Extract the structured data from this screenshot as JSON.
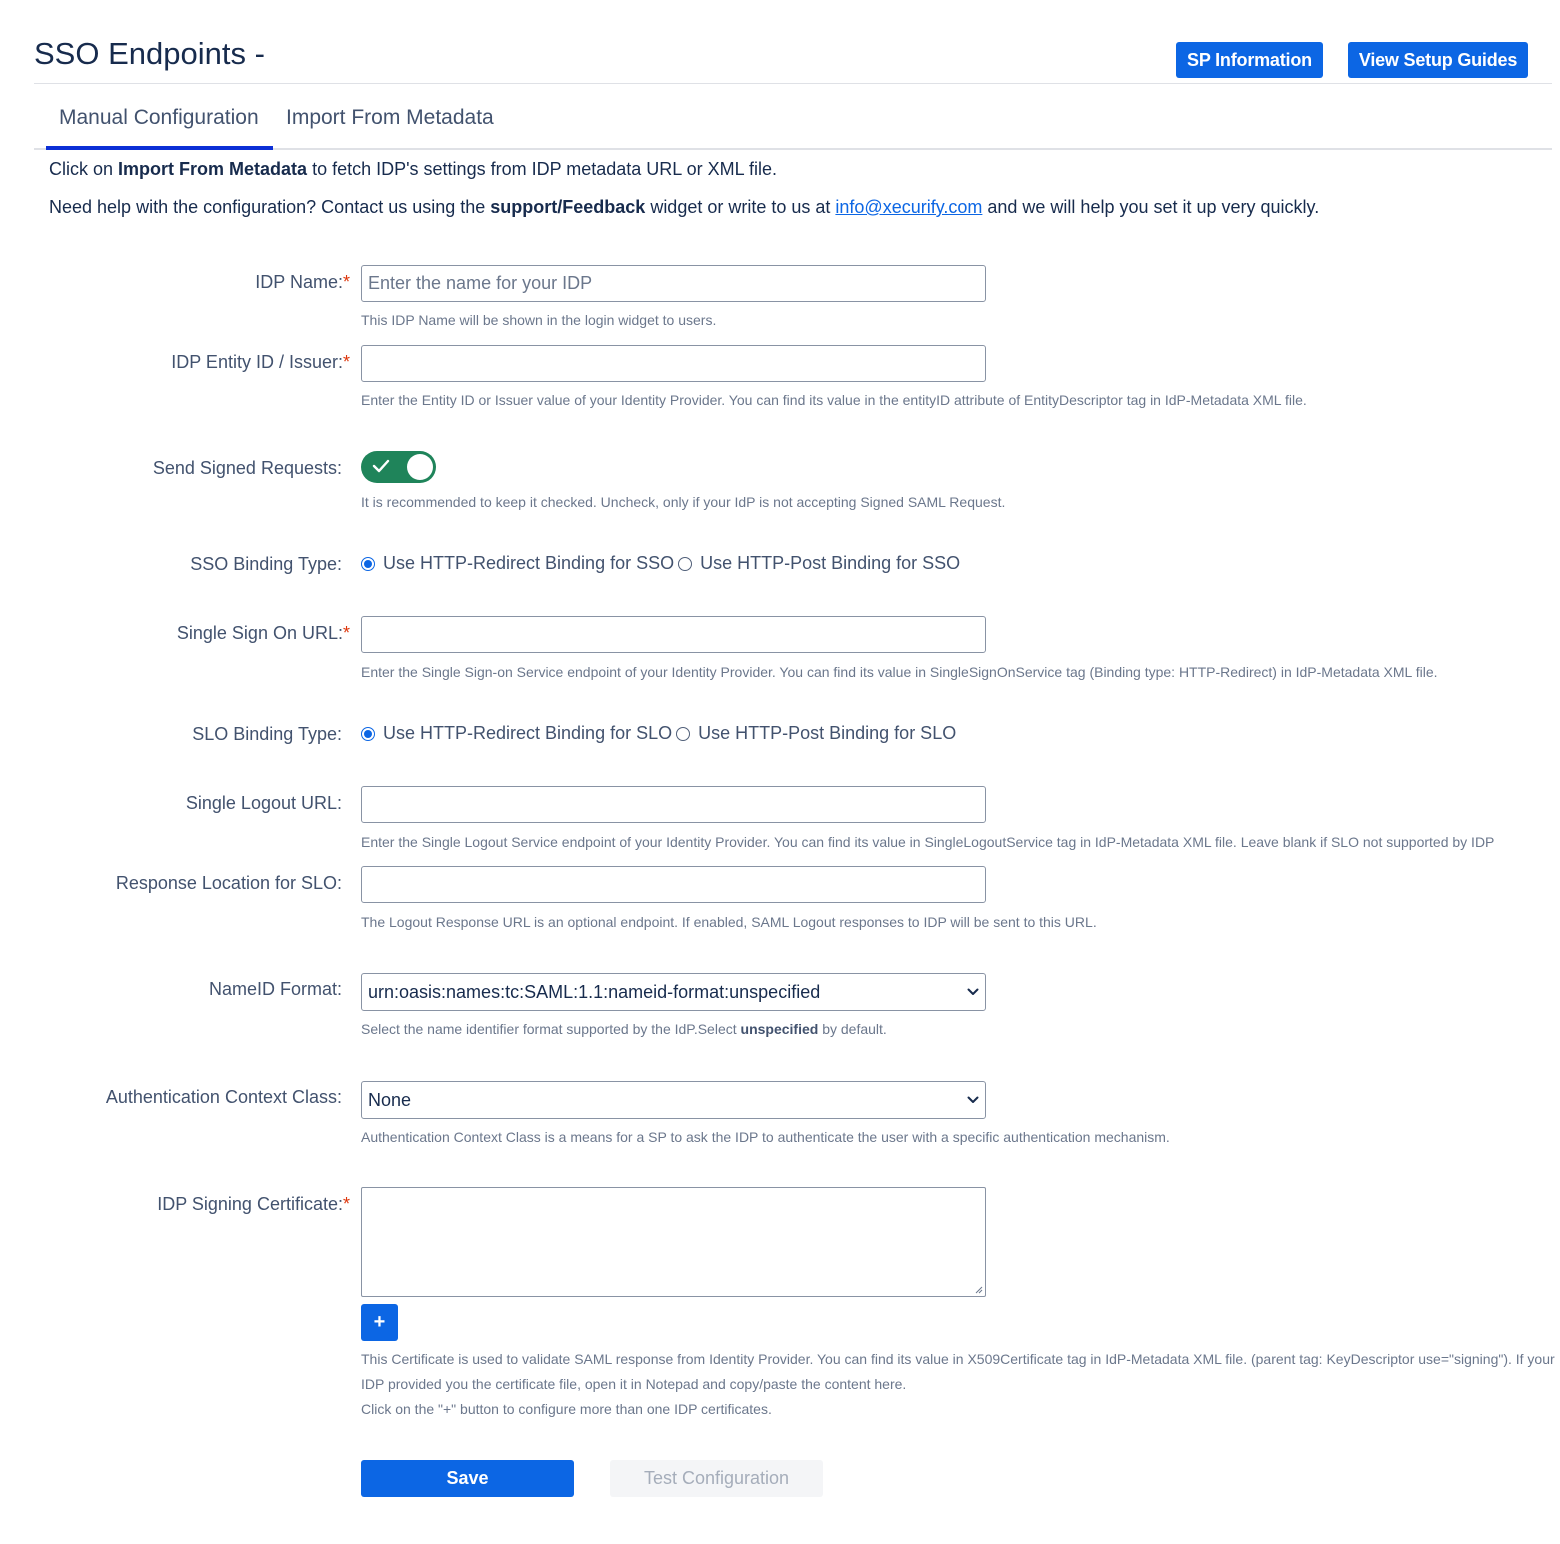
{
  "header": {
    "title": "SSO Endpoints -",
    "sp_info_button": "SP Information",
    "setup_guides_button": "View Setup Guides"
  },
  "tabs": [
    {
      "label": "Manual Configuration",
      "active": true
    },
    {
      "label": "Import From Metadata",
      "active": false
    }
  ],
  "intro": {
    "line1_pre": "Click on ",
    "line1_bold": "Import From Metadata",
    "line1_post": " to fetch IDP's settings from IDP metadata URL or XML file.",
    "line2_pre": "Need help with the configuration? Contact us using the ",
    "line2_bold": "support/Feedback",
    "line2_mid": " widget or write to us at ",
    "line2_link": "info@xecurify.com",
    "line2_post": " and we will help you set it up very quickly."
  },
  "form": {
    "idp_name": {
      "label": "IDP Name:",
      "required": "*",
      "value": "",
      "placeholder": "Enter the name for your IDP",
      "help": "This IDP Name will be shown in the login widget to users."
    },
    "entity_id": {
      "label": "IDP Entity ID / Issuer:",
      "required": "*",
      "value": "",
      "help": "Enter the Entity ID or Issuer value of your Identity Provider. You can find its value in the entityID attribute of EntityDescriptor tag in IdP-Metadata XML file."
    },
    "signed_requests": {
      "label": "Send Signed Requests:",
      "checked": true,
      "help": "It is recommended to keep it checked. Uncheck, only if your IdP is not accepting Signed SAML Request."
    },
    "sso_binding": {
      "label": "SSO Binding Type:",
      "options": [
        "Use HTTP-Redirect Binding for SSO",
        "Use HTTP-Post Binding for SSO"
      ],
      "selected": "Use HTTP-Redirect Binding for SSO"
    },
    "sso_url": {
      "label": "Single Sign On URL:",
      "required": "*",
      "value": "",
      "help": "Enter the Single Sign-on Service endpoint of your Identity Provider. You can find its value in SingleSignOnService tag (Binding type: HTTP-Redirect) in IdP-Metadata XML file."
    },
    "slo_binding": {
      "label": "SLO Binding Type:",
      "options": [
        "Use HTTP-Redirect Binding for SLO",
        "Use HTTP-Post Binding for SLO"
      ],
      "selected": "Use HTTP-Redirect Binding for SLO"
    },
    "slo_url": {
      "label": "Single Logout URL:",
      "value": "",
      "help": "Enter the Single Logout Service endpoint of your Identity Provider. You can find its value in SingleLogoutService tag in IdP-Metadata XML file. Leave blank if SLO not supported by IDP"
    },
    "slo_response": {
      "label": "Response Location for SLO:",
      "value": "",
      "help": "The Logout Response URL is an optional endpoint. If enabled, SAML Logout responses to IDP will be sent to this URL."
    },
    "nameid_format": {
      "label": "NameID Format:",
      "selected": "urn:oasis:names:tc:SAML:1.1:nameid-format:unspecified",
      "help_pre": "Select the name identifier format supported by the IdP.Select ",
      "help_bold": "unspecified",
      "help_post": " by default."
    },
    "auth_context": {
      "label": "Authentication Context Class:",
      "selected": "None",
      "help": "Authentication Context Class is a means for a SP to ask the IDP to authenticate the user with a specific authentication mechanism."
    },
    "certificate": {
      "label": "IDP Signing Certificate:",
      "required": "*",
      "value": "",
      "add_label": "+",
      "help_line1": "This Certificate is used to validate SAML response from Identity Provider. You can find its value in X509Certificate tag in IdP-Metadata XML file. (parent tag: KeyDescriptor use=\"signing\"). If your",
      "help_line2": "IDP provided you the certificate file, open it in Notepad and copy/paste the content here.",
      "help_line3": "Click on the \"+\" button to configure more than one IDP certificates."
    }
  },
  "actions": {
    "save": "Save",
    "test": "Test Configuration"
  },
  "colors": {
    "primary": "#0c66e4",
    "toggle_on": "#1f845a",
    "tab_underline": "#0c2fd6",
    "required": "#de350b"
  }
}
